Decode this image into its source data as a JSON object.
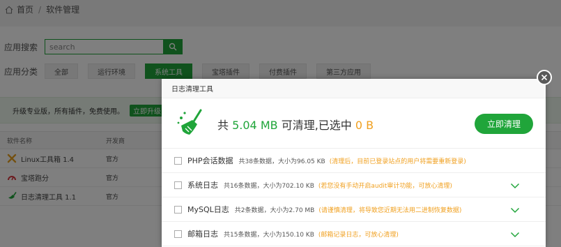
{
  "breadcrumb": {
    "home": "首页",
    "separator": "/",
    "current": "软件管理"
  },
  "search": {
    "label": "应用搜索",
    "placeholder": "search"
  },
  "category": {
    "label": "应用分类",
    "items": [
      "全部",
      "运行环境",
      "系统工具",
      "宝塔插件",
      "付费插件",
      "第三方应用"
    ],
    "active_index": 2
  },
  "promo": {
    "text": "升级专业版，所有插件，免费使用。",
    "button": "立即升级"
  },
  "table": {
    "headers": [
      "软件名称",
      "开发商"
    ],
    "rows": [
      {
        "icon": "linux-toolbox-icon",
        "name": "Linux工具箱 1.4",
        "vendor": "官方"
      },
      {
        "icon": "bt-score-icon",
        "name": "宝塔跑分",
        "vendor": "官方"
      },
      {
        "icon": "broom-icon",
        "name": "日志清理工具 1.1",
        "vendor": "官方"
      }
    ]
  },
  "modal": {
    "title": "日志清理工具",
    "summary_prefix": "共",
    "total_size": "5.04 MB",
    "summary_mid": "可清理,已选中",
    "selected_size": "0 B",
    "clean_button": "立即清理",
    "items": [
      {
        "name": "PHP会话数据",
        "meta": "共38条数据，大小为96.05 KB",
        "note": "(清理后，目前已登录站点的用户将需要重新登录)",
        "expandable": false
      },
      {
        "name": "系统日志",
        "meta": "共16条数据，大小为702.10 KB",
        "note": "(若您没有手动开启audit审计功能，可放心清理)",
        "expandable": true
      },
      {
        "name": "MySQL日志",
        "meta": "共2条数据，大小为2.70 MB",
        "note": "(请谨慎清理，将导致您近期无法用二进制恢复数据)",
        "expandable": true
      },
      {
        "name": "邮箱日志",
        "meta": "共15条数据，大小为150.10 KB",
        "note": "(邮箱记录日志，可放心清理)",
        "expandable": true
      }
    ]
  },
  "colors": {
    "brand": "#20a53a",
    "warning": "#f0a020"
  }
}
